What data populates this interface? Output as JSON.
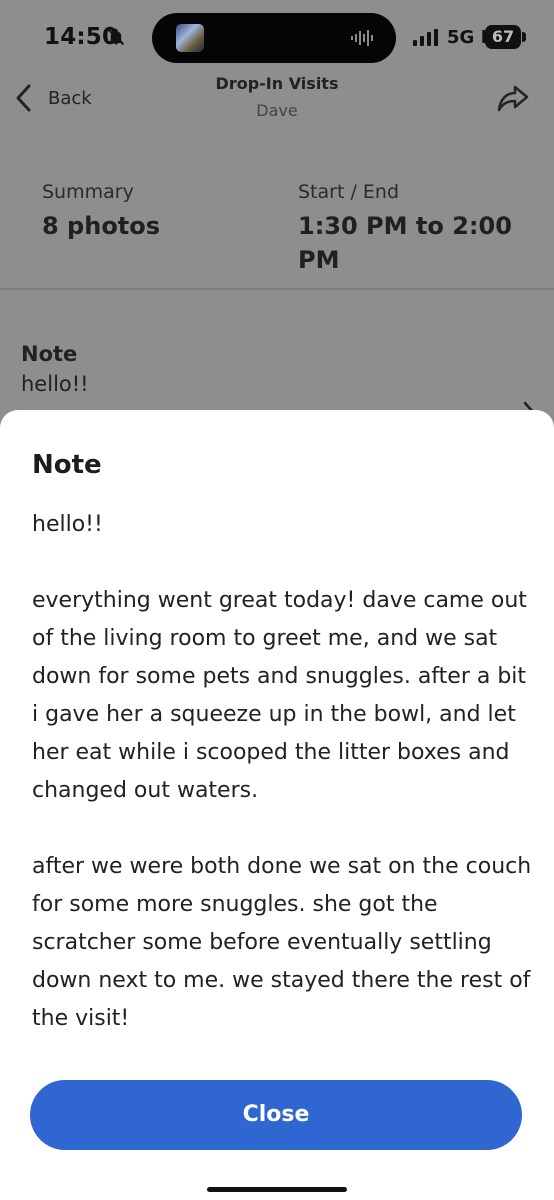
{
  "status_bar": {
    "time": "14:50",
    "network": "5G E",
    "battery": "67",
    "icons": [
      "bell-off-icon",
      "media-thumbnail-icon",
      "waveform-icon",
      "signal-icon"
    ]
  },
  "header": {
    "back_label": "Back",
    "title": "Drop-In Visits",
    "subtitle": "Dave",
    "icons": [
      "back-chevron-icon",
      "share-icon"
    ]
  },
  "summary": {
    "summary_label": "Summary",
    "summary_value": "8 photos",
    "start_end_label": "Start / End",
    "start_end_value": "1:30 PM to 2:00 PM"
  },
  "background_note": {
    "title": "Note",
    "preview": "hello!!",
    "chevron_icon": "chevron-right-icon"
  },
  "note_sheet": {
    "title": "Note",
    "paragraphs": [
      "hello!!",
      "everything went great today! dave came out of the living room to greet me, and we sat down for some pets and snuggles. after a bit i gave her a squeeze up in the bowl, and let her eat while i scooped the litter boxes and changed out waters.",
      "after we were both done we sat on the couch for some more snuggles. she got the scratcher some before eventually settling down next to me. we stayed there the rest of the visit!"
    ],
    "close_label": "Close"
  },
  "colors": {
    "background_dim": "#8e8e8e",
    "sheet_background": "#ffffff",
    "button_blue": "#2f66d0",
    "text_dark": "#222222"
  }
}
